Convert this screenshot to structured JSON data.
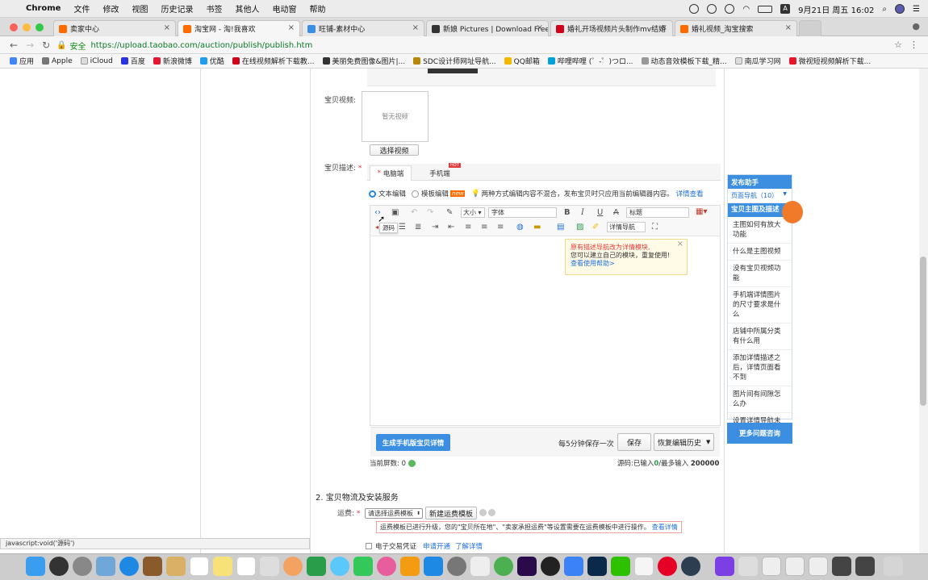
{
  "menubar": {
    "app_name": "Chrome",
    "menus": [
      "文件",
      "修改",
      "视图",
      "历史记录",
      "书签",
      "其他人",
      "电动窗",
      "帮助"
    ],
    "clock": "9月21日 周五 16:02"
  },
  "tabs": [
    {
      "title": "卖家中心",
      "color": "#ff6a00"
    },
    {
      "title": "淘宝网 - 淘!我喜欢",
      "color": "#ff6a00"
    },
    {
      "title": "旺铺-素材中心",
      "color": "#3a8ee6"
    },
    {
      "title": "新娘 Pictures | Download Free",
      "color": "#333333"
    },
    {
      "title": "婚礼开场视频片头制作mv结婚",
      "color": "#d0021b"
    },
    {
      "title": "婚礼视频_淘宝搜索",
      "color": "#ff6a00"
    }
  ],
  "address": {
    "secure_label": "安全",
    "url": "https://upload.taobao.com/auction/publish/publish.htm"
  },
  "bookmarks": [
    "应用",
    "Apple",
    "iCloud",
    "百度",
    "新浪微博",
    "优酷",
    "在线视频解析下载教...",
    "美丽免费图像&图片|...",
    "SDC设计师网址导航...",
    "QQ邮箱",
    "哔哩哔哩 (゜-゜)つロ...",
    "动态音效模板下载_精...",
    "南瓜学习网",
    "微视短视频解析下载..."
  ],
  "form": {
    "video_label": "宝贝视频:",
    "video_empty": "暂无视频",
    "choose_video": "选择视频",
    "desc_label": "宝贝描述:",
    "tab_pc": "电脑端",
    "tab_mobile": "手机端",
    "hot_badge": "HOT",
    "mode_text": "文本编辑",
    "mode_module": "模板编辑",
    "new_badge": "new",
    "mode_tip": "两种方式编辑内容不混合，发布宝贝时只应用当前编辑器内容。",
    "mode_more": "详情查看",
    "toolbar": {
      "size": "大小",
      "font": "字体",
      "heading": "标题",
      "bold": "B",
      "italic": "I",
      "underline": "U",
      "strike": "A",
      "detail_nav": "详情导航",
      "source_tooltip": "源码"
    },
    "popup": {
      "line1": "原有描述导航改为详情模块,",
      "line2": "您可以建立自己的模块，重复使用!",
      "link": "查看使用帮助>"
    },
    "gen_mobile": "生成手机版宝贝详情",
    "autosave": "每5分钟保存一次",
    "save": "保存",
    "restore": "恢复编辑历史",
    "screens_label": "当前屏数: 0",
    "src_count_label": "源码:已输入",
    "src_count_value": "0",
    "src_max_label": "/最多输入",
    "src_max_value": "200000",
    "section2": "2. 宝贝物流及安装服务",
    "freight_label": "运费:",
    "freight_select": "请选择运费模板",
    "new_freight": "新建运费模板",
    "freight_notice": "运费模板已进行升级，您的\"宝贝所在地\"、\"卖家承担运费\"等设置需要在运费模板中进行操作。",
    "freight_more": "查看详情",
    "invoice_label": "电子交易凭证",
    "invoice_apply": "申请开通",
    "invoice_learn": "了解详情"
  },
  "helper": {
    "title": "发布助手",
    "nav_label": "页面导航（10）",
    "section": "宝贝主图及描述",
    "items": [
      "主图如何有放大功能",
      "什么是主图视频",
      "没有宝贝视频功能",
      "手机端详情图片的尺寸要求是什么",
      "店铺中所属分类有什么用",
      "添加详情描述之后，详情页面看不到",
      "图片间有间隙怎么办",
      "设置详情导航未显示"
    ],
    "more": "更多问题咨询"
  },
  "statusbar": "javascript:void('源码')"
}
